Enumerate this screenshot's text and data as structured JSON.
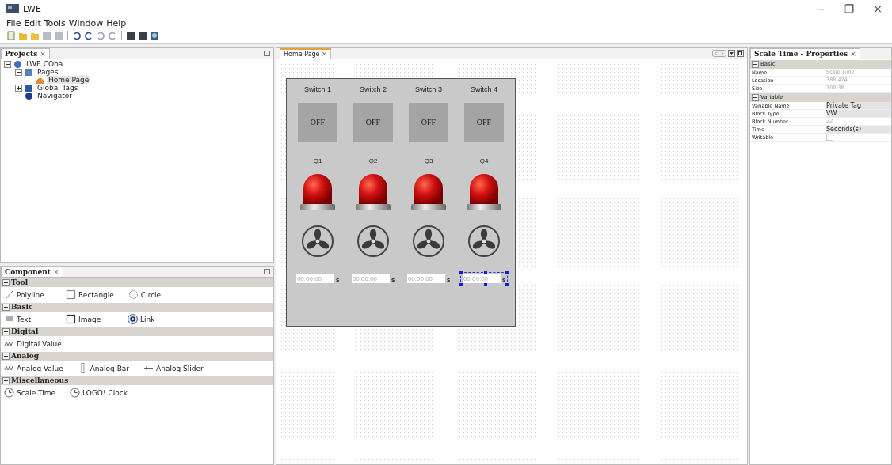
{
  "window": {
    "title": "LWE",
    "controls": [
      "−",
      "❐",
      "×"
    ]
  },
  "menu": [
    "File",
    "Edit",
    "Tools",
    "Window",
    "Help"
  ],
  "projects": {
    "title": "Projects",
    "close": "×",
    "tree": [
      {
        "label": "LWE COba",
        "kind": "project",
        "expanded": true,
        "selected": false,
        "children": [
          {
            "label": "Pages",
            "kind": "pages",
            "expanded": true,
            "selected": false,
            "children": [
              {
                "label": "Home Page",
                "kind": "page",
                "selected": true
              }
            ]
          },
          {
            "label": "Global Tags",
            "kind": "tags",
            "expanded": false,
            "selected": false
          },
          {
            "label": "Navigator",
            "kind": "navigator",
            "selected": false
          }
        ]
      }
    ]
  },
  "component": {
    "title": "Component",
    "close": "×",
    "sections": [
      {
        "name": "Tool",
        "expanded": true,
        "items": [
          {
            "label": "Polyline",
            "kind": "polyline"
          },
          {
            "label": "Rectangle",
            "kind": "rectangle"
          },
          {
            "label": "Circle",
            "kind": "circle"
          }
        ]
      },
      {
        "name": "Basic",
        "expanded": true,
        "items": [
          {
            "label": "Text",
            "kind": "text"
          },
          {
            "label": "Image",
            "kind": "image"
          },
          {
            "label": "Link",
            "kind": "link"
          }
        ]
      },
      {
        "name": "Digital",
        "expanded": true,
        "items": [
          {
            "label": "Digital Value",
            "kind": "digital"
          }
        ]
      },
      {
        "name": "Analog",
        "expanded": true,
        "items": [
          {
            "label": "Analog Value",
            "kind": "analog"
          },
          {
            "label": "Analog Bar",
            "kind": "bar"
          },
          {
            "label": "Analog Slider",
            "kind": "slider"
          }
        ]
      },
      {
        "name": "Miscellaneous",
        "expanded": true,
        "items": [
          {
            "label": "Scale Time",
            "kind": "clock"
          },
          {
            "label": "LOGO! Clock",
            "kind": "clock2"
          }
        ]
      }
    ]
  },
  "editor": {
    "tab": "Home Page",
    "close": "×",
    "columns": [
      {
        "switch_label": "Switch 1",
        "button": "OFF",
        "lamp_label": "Q1",
        "timer": "00:00:00",
        "unit": "s",
        "selected": false
      },
      {
        "switch_label": "Switch 2",
        "button": "OFF",
        "lamp_label": "Q2",
        "timer": "00:00:00",
        "unit": "s",
        "selected": false
      },
      {
        "switch_label": "Switch 3",
        "button": "OFF",
        "lamp_label": "Q3",
        "timer": "00:00:00",
        "unit": "s",
        "selected": false
      },
      {
        "switch_label": "Switch 4",
        "button": "OFF",
        "lamp_label": "Q4",
        "timer": "00:00:00",
        "unit": "s",
        "selected": true
      }
    ]
  },
  "properties": {
    "title": "Scale Time - Properties",
    "close": "×",
    "sections": [
      {
        "name": "Basic",
        "expanded": true,
        "rows": [
          {
            "name": "Name",
            "value": "Scale Time",
            "kind": "readonly"
          },
          {
            "name": "Location",
            "value": "388,474",
            "kind": "readonly"
          },
          {
            "name": "Size",
            "value": "100,38",
            "kind": "readonly"
          }
        ]
      },
      {
        "name": "Variable",
        "expanded": true,
        "rows": [
          {
            "name": "Variable Name",
            "value": "Private Tag",
            "kind": "dropdown"
          },
          {
            "name": "Block Type",
            "value": "VW",
            "kind": "dropdown"
          },
          {
            "name": "Block Number",
            "value": "22",
            "kind": "readonly"
          },
          {
            "name": "Time",
            "value": "Seconds(s)",
            "kind": "dropdown"
          },
          {
            "name": "Writable",
            "kind": "checkbox",
            "checked": false
          }
        ]
      }
    ]
  }
}
